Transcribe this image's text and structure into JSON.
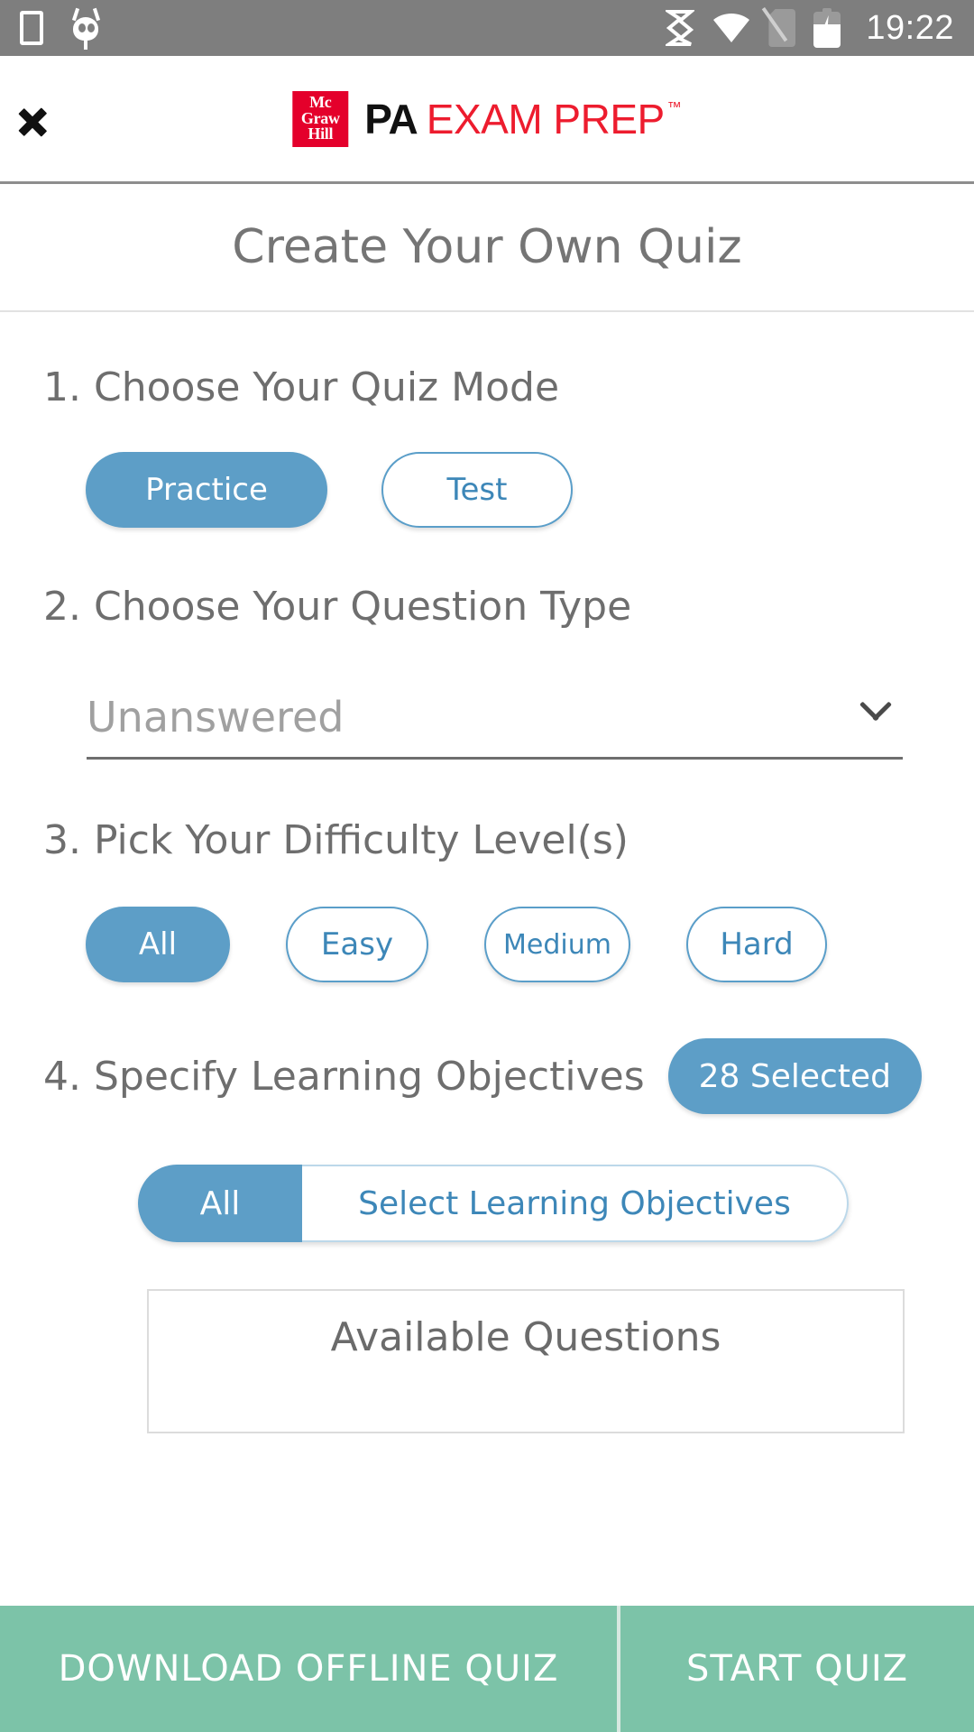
{
  "status_bar": {
    "time": "19:22",
    "icons": {
      "screenshot": "screenshot-icon",
      "cyanogen": "cyanogenmod-icon",
      "sync": "sync-icon",
      "wifi": "wifi-icon",
      "sim": "no-sim-icon",
      "battery": "battery-charging-icon"
    },
    "bg_color": "#7e7e7e"
  },
  "app_bar": {
    "back_icon": "chevron-left-icon",
    "logo": {
      "publisher_line1": "Mc",
      "publisher_line2": "Graw",
      "publisher_line3": "Hill",
      "brand_black": "PA",
      "brand_red": "EXAM PREP",
      "trademark": "™",
      "red": "#ed1c2e",
      "box_red": "#e4002b"
    }
  },
  "page": {
    "title": "Create Your Own Quiz"
  },
  "sections": {
    "quiz_mode": {
      "title": "1. Choose Your Quiz Mode",
      "options": [
        {
          "label": "Practice",
          "selected": true
        },
        {
          "label": "Test",
          "selected": false
        }
      ]
    },
    "question_type": {
      "title": "2. Choose Your Question Type",
      "selected_value": "Unanswered",
      "chevron": "chevron-down-icon"
    },
    "difficulty": {
      "title": "3. Pick Your Difficulty Level(s)",
      "options": [
        {
          "label": "All",
          "selected": true
        },
        {
          "label": "Easy",
          "selected": false
        },
        {
          "label": "Medium",
          "selected": false
        },
        {
          "label": "Hard",
          "selected": false
        }
      ]
    },
    "learning_objectives": {
      "title": "4. Specify Learning Objectives",
      "badge": "28 Selected",
      "segments": [
        {
          "label": "All",
          "selected": true
        },
        {
          "label": "Select Learning Objectives",
          "selected": false
        }
      ],
      "available_questions_title": "Available Questions"
    }
  },
  "bottom_bar": {
    "download_label": "DOWNLOAD OFFLINE QUIZ",
    "start_label": "START QUIZ",
    "bg_color": "#7cc3a8"
  },
  "theme": {
    "accent_blue": "#5d9ec7",
    "accent_blue_text": "#3d87b8",
    "text_gray": "#6e6e6e",
    "placeholder_gray": "#a0a0a0"
  }
}
